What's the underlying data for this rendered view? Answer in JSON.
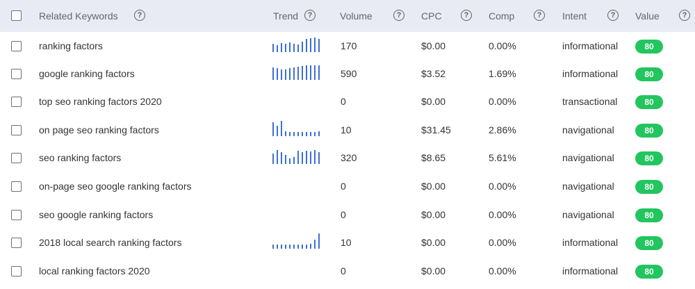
{
  "header": {
    "keywords_label": "Related Keywords",
    "trend_label": "Trend",
    "volume_label": "Volume",
    "cpc_label": "CPC",
    "comp_label": "Comp",
    "intent_label": "Intent",
    "value_label": "Value",
    "help_glyph": "?"
  },
  "colors": {
    "header_bg": "#e9ebf4",
    "trend_bar": "#3b6fd8",
    "value_badge": "#22c55e"
  },
  "rows": [
    {
      "keyword": "ranking factors",
      "volume": "170",
      "cpc": "$0.00",
      "comp": "0.00%",
      "intent": "informational",
      "value": "80",
      "trend": [
        0.55,
        0.45,
        0.6,
        0.55,
        0.65,
        0.55,
        0.5,
        0.7,
        0.85,
        0.9,
        0.95,
        0.85
      ]
    },
    {
      "keyword": "google ranking factors",
      "volume": "590",
      "cpc": "$3.52",
      "comp": "1.69%",
      "intent": "informational",
      "value": "80",
      "trend": [
        0.8,
        0.75,
        0.7,
        0.7,
        0.75,
        0.8,
        0.85,
        0.9,
        0.95,
        0.95,
        0.95,
        0.95
      ]
    },
    {
      "keyword": "top seo ranking factors 2020",
      "volume": "0",
      "cpc": "$0.00",
      "comp": "0.00%",
      "intent": "transactional",
      "value": "80",
      "trend": []
    },
    {
      "keyword": "on page seo ranking factors",
      "volume": "10",
      "cpc": "$31.45",
      "comp": "2.86%",
      "intent": "navigational",
      "value": "80",
      "trend": [
        0.9,
        0.7,
        1.0,
        0.3,
        0.25,
        0.25,
        0.25,
        0.25,
        0.25,
        0.25,
        0.25,
        0.3
      ]
    },
    {
      "keyword": "seo ranking factors",
      "volume": "320",
      "cpc": "$8.65",
      "comp": "5.61%",
      "intent": "navigational",
      "value": "80",
      "trend": [
        0.7,
        0.9,
        0.75,
        0.6,
        0.35,
        0.45,
        0.85,
        0.75,
        0.85,
        0.8,
        0.9,
        0.75
      ]
    },
    {
      "keyword": "on-page seo google ranking factors",
      "volume": "0",
      "cpc": "$0.00",
      "comp": "0.00%",
      "intent": "navigational",
      "value": "80",
      "trend": []
    },
    {
      "keyword": "seo google ranking factors",
      "volume": "0",
      "cpc": "$0.00",
      "comp": "0.00%",
      "intent": "navigational",
      "value": "80",
      "trend": []
    },
    {
      "keyword": "2018 local search ranking factors",
      "volume": "10",
      "cpc": "$0.00",
      "comp": "0.00%",
      "intent": "informational",
      "value": "80",
      "trend": [
        0.25,
        0.25,
        0.25,
        0.25,
        0.25,
        0.25,
        0.25,
        0.25,
        0.25,
        0.3,
        0.6,
        1.0
      ]
    },
    {
      "keyword": "local ranking factors 2020",
      "volume": "0",
      "cpc": "$0.00",
      "comp": "0.00%",
      "intent": "informational",
      "value": "80",
      "trend": []
    }
  ]
}
